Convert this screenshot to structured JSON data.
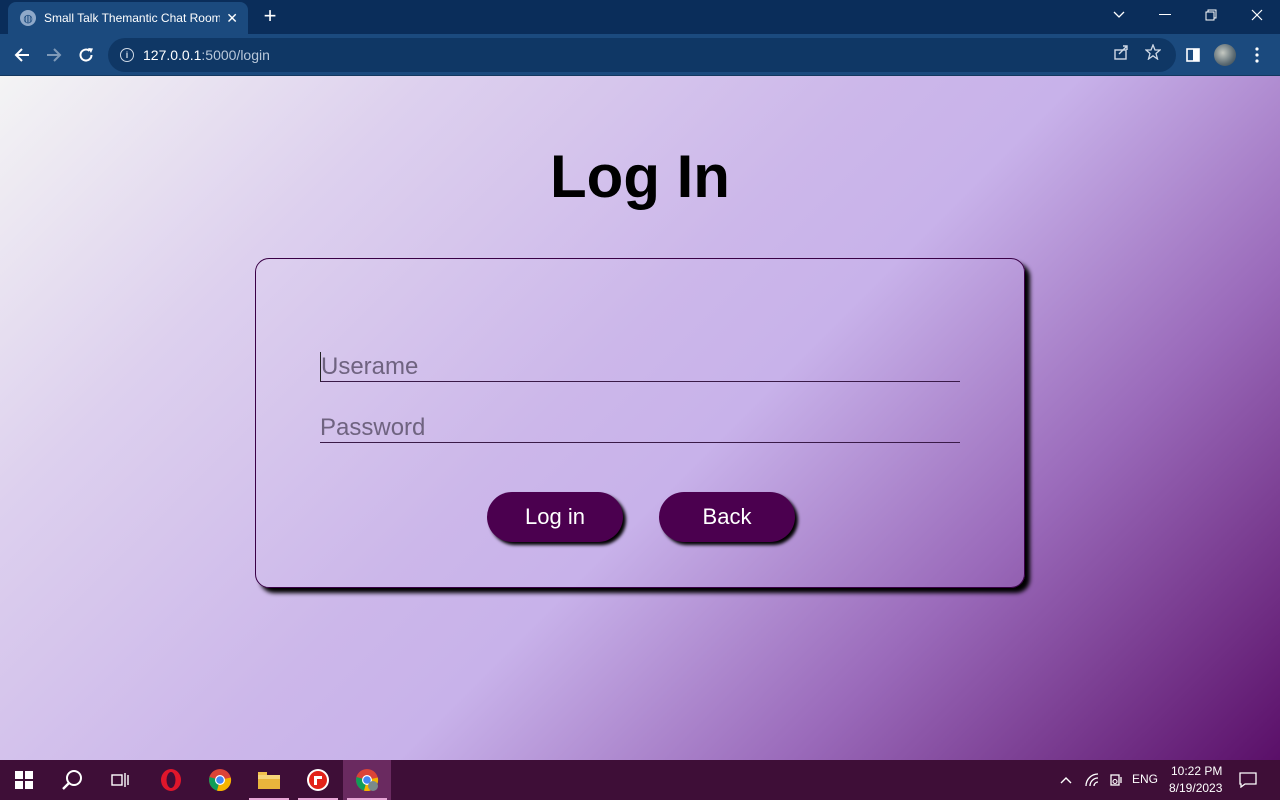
{
  "browser": {
    "tab_title": "Small Talk Themantic Chat Room",
    "url_host": "127.0.0.1",
    "url_path": ":5000/login"
  },
  "page": {
    "title": "Log In",
    "form": {
      "username_placeholder": "Userame",
      "password_placeholder": "Password",
      "login_label": "Log in",
      "back_label": "Back"
    }
  },
  "taskbar": {
    "apps": [
      "windows-start",
      "search",
      "task-view",
      "opera",
      "chrome",
      "file-explorer",
      "app-red",
      "chrome-profile"
    ],
    "language": "ENG",
    "time": "10:22 PM",
    "date": "8/19/2023"
  },
  "colors": {
    "button_bg": "#4b004f",
    "chrome_bg": "#0a2d5a",
    "taskbar_bg": "#3e0e37"
  }
}
